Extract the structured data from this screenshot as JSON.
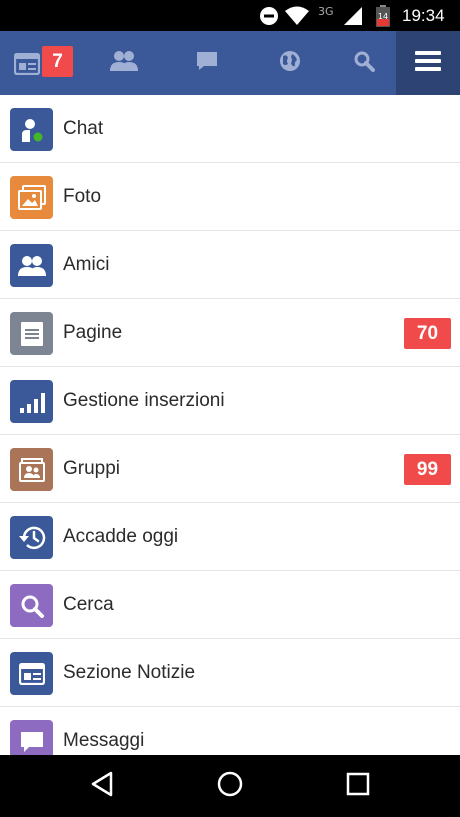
{
  "status_bar": {
    "network": "3G",
    "battery_level": "14",
    "time": "19:34"
  },
  "top_nav": {
    "news_badge": "7",
    "icons": [
      "news-feed-icon",
      "friends-icon",
      "messages-icon",
      "globe-icon",
      "search-icon",
      "hamburger-menu-icon"
    ]
  },
  "menu": {
    "items": [
      {
        "label": "Chat",
        "icon": "chat-presence-icon",
        "color": "#3b5998",
        "badge": ""
      },
      {
        "label": "Foto",
        "icon": "photo-icon",
        "color": "#e78a3c",
        "badge": ""
      },
      {
        "label": "Amici",
        "icon": "friends-icon",
        "color": "#3b5998",
        "badge": ""
      },
      {
        "label": "Pagine",
        "icon": "page-icon",
        "color": "#7d8593",
        "badge": "70"
      },
      {
        "label": "Gestione inserzioni",
        "icon": "ads-chart-icon",
        "color": "#3b5998",
        "badge": ""
      },
      {
        "label": "Gruppi",
        "icon": "groups-icon",
        "color": "#a97458",
        "badge": "99"
      },
      {
        "label": "Accadde oggi",
        "icon": "history-icon",
        "color": "#3b5998",
        "badge": ""
      },
      {
        "label": "Cerca",
        "icon": "search-icon",
        "color": "#8c6bc1",
        "badge": ""
      },
      {
        "label": "Sezione Notizie",
        "icon": "news-feed-icon",
        "color": "#3b5998",
        "badge": ""
      },
      {
        "label": "Messaggi",
        "icon": "message-icon",
        "color": "#8c6bc1",
        "badge": ""
      }
    ]
  },
  "colors": {
    "facebook_blue": "#3b5998",
    "badge_red": "#f04a4a",
    "menu_active_bg": "#2d4373"
  },
  "android_nav": {
    "icons": [
      "back-icon",
      "home-icon",
      "recent-apps-icon"
    ]
  }
}
